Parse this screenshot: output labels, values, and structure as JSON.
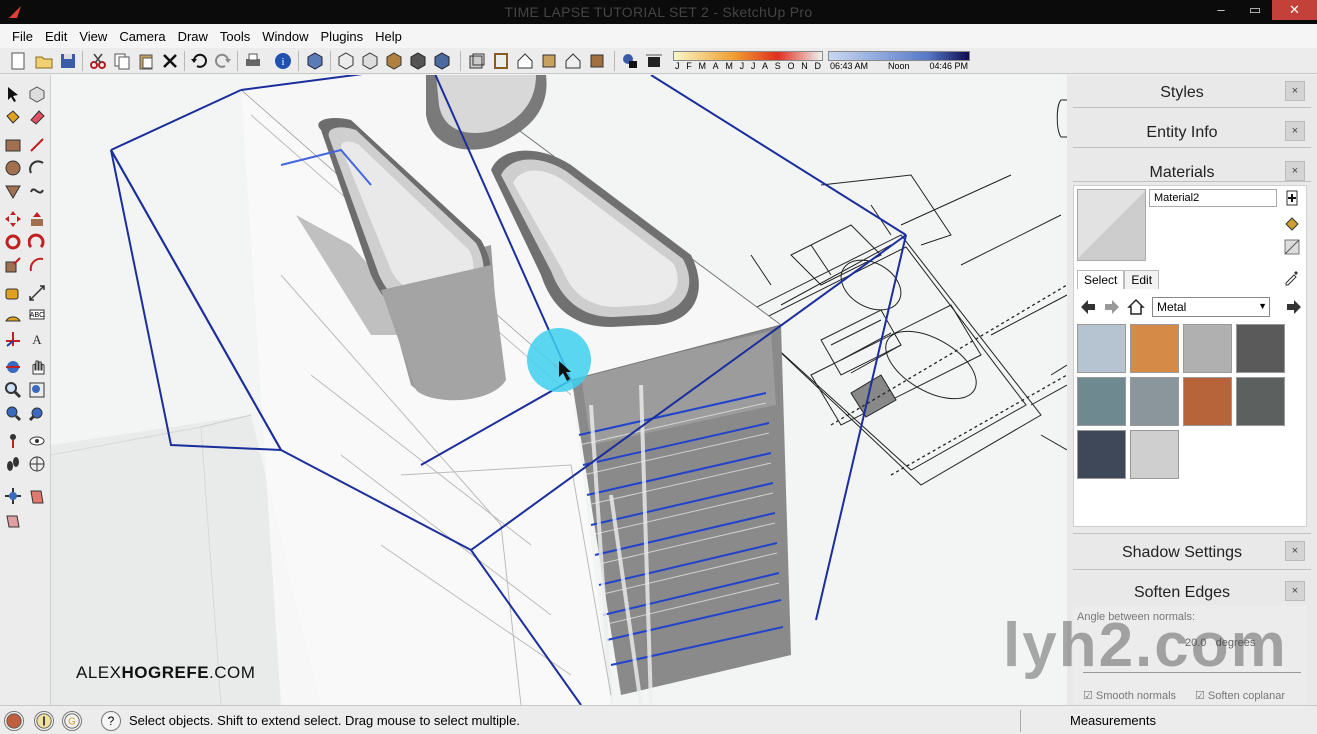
{
  "window": {
    "title": "TIME LAPSE TUTORIAL SET 2 - SketchUp Pro",
    "controls": [
      "minimize",
      "maximize",
      "close"
    ]
  },
  "menu": [
    "File",
    "Edit",
    "View",
    "Camera",
    "Draw",
    "Tools",
    "Window",
    "Plugins",
    "Help"
  ],
  "shadow": {
    "months": [
      "J",
      "F",
      "M",
      "A",
      "M",
      "J",
      "J",
      "A",
      "S",
      "O",
      "N",
      "D"
    ],
    "time_start": "06:43 AM",
    "time_mid": "Noon",
    "time_end": "04:46 PM"
  },
  "viewport": {
    "watermark_regular": "ALEX",
    "watermark_bold": "HOGREFE",
    "watermark_suffix": ".COM"
  },
  "tray": {
    "panels": {
      "styles": "Styles",
      "entity_info": "Entity Info",
      "materials": "Materials",
      "shadow_settings": "Shadow Settings",
      "soften_edges": "Soften Edges"
    },
    "close_glyph": "×",
    "materials": {
      "name": "Material2",
      "tabs": [
        "Select",
        "Edit"
      ],
      "collection": "Metal",
      "swatch_colors": [
        "#b6c4d2",
        "#d58a48",
        "#b0b0b0",
        "#5a5a5a",
        "#6e8a90",
        "#8a959c",
        "#b8643a",
        "#5c605e",
        "#3e4858",
        "#cfcfcf"
      ]
    },
    "soften": {
      "angle_label": "Angle between normals:",
      "angle_value": "20.0",
      "angle_unit": "degrees",
      "smooth_normals": "Smooth normals",
      "soften_coplanar": "Soften coplanar"
    }
  },
  "overlay_watermark": "lyh2.com",
  "status": {
    "message": "Select objects. Shift to extend select. Drag mouse to select multiple.",
    "measurements_label": "Measurements",
    "help_glyph": "?"
  }
}
